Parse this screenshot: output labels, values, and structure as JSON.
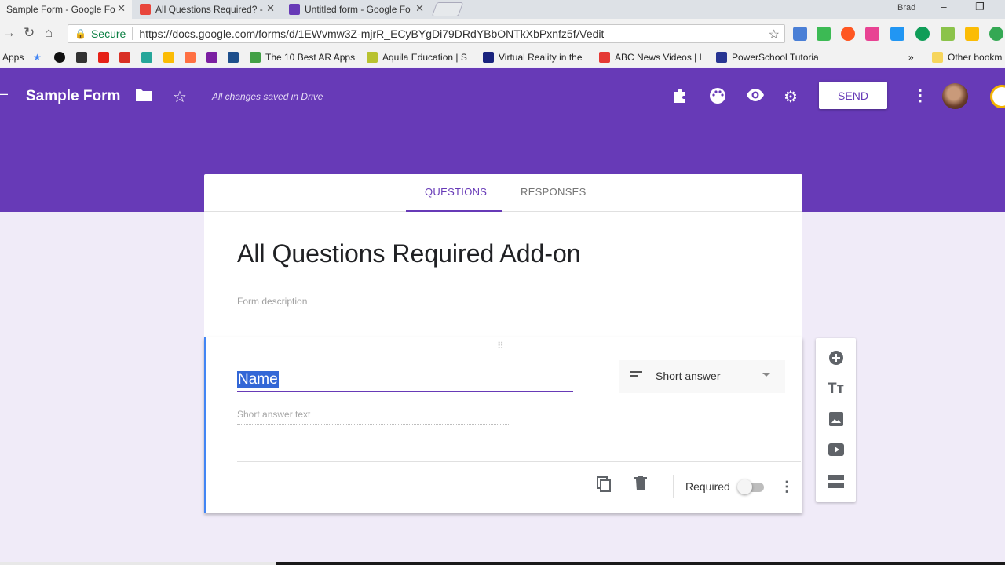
{
  "browser": {
    "tabs": [
      {
        "title": "Sample Form - Google Fo",
        "active": true
      },
      {
        "title": "All Questions Required? -",
        "active": false
      },
      {
        "title": "Untitled form - Google Fo",
        "active": false
      }
    ],
    "window_user": "Brad",
    "address": {
      "secure_label": "Secure",
      "url": "https://docs.google.com/forms/d/1EWvmw3Z-mjrR_ECyBYgDi79DRdYBbONTkXbPxnfz5fA/edit"
    },
    "bookmarks": [
      "Apps",
      "The 10 Best AR Apps",
      "Aquila Education | S",
      "Virtual Reality in the",
      "ABC News Videos | L",
      "PowerSchool Tutoria",
      "»",
      "Other bookm"
    ]
  },
  "header": {
    "form_title": "Sample Form",
    "saved_status": "All changes saved in Drive",
    "send_label": "SEND",
    "color": "#673ab7"
  },
  "editor": {
    "tabs": [
      "QUESTIONS",
      "RESPONSES"
    ],
    "form_heading": "All Questions Required Add-on",
    "form_description_placeholder": "Form description"
  },
  "question": {
    "title": "Name",
    "type": "Short answer",
    "answer_placeholder": "Short answer text",
    "required_label": "Required",
    "required": false
  },
  "side_toolbar": [
    "add-question",
    "add-title",
    "add-image",
    "add-video",
    "add-section"
  ]
}
